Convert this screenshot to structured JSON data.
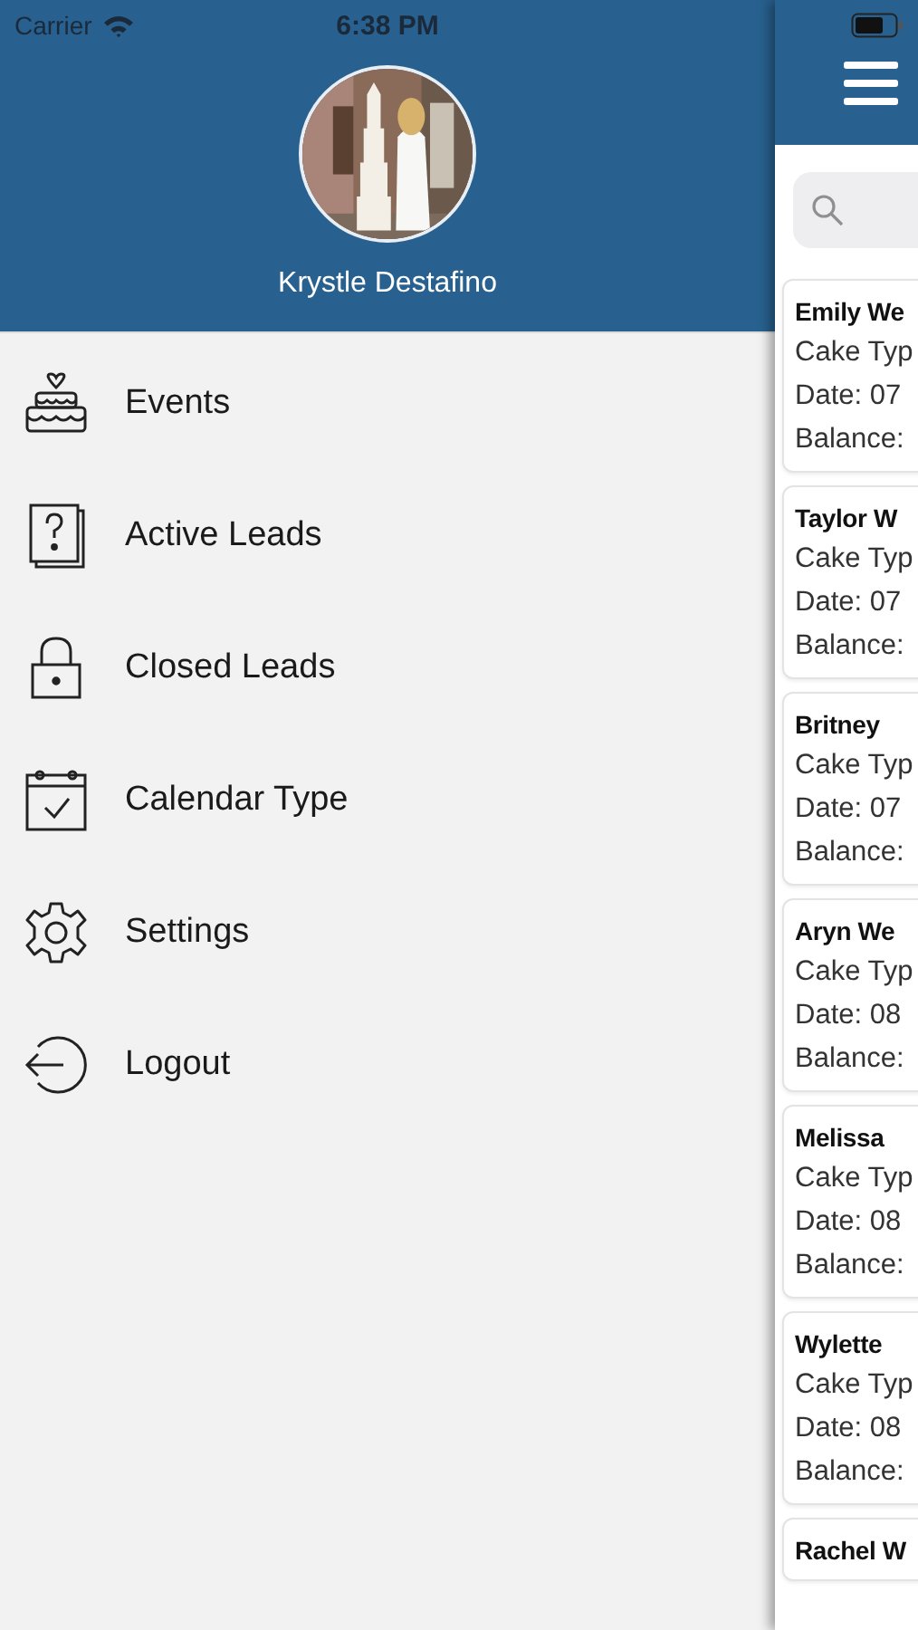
{
  "status_bar": {
    "carrier": "Carrier",
    "time": "6:38 PM"
  },
  "profile": {
    "name": "Krystle Destafino"
  },
  "menu": [
    {
      "label": "Events"
    },
    {
      "label": "Active Leads"
    },
    {
      "label": "Closed Leads"
    },
    {
      "label": "Calendar Type"
    },
    {
      "label": "Settings"
    },
    {
      "label": "Logout"
    }
  ],
  "cards": [
    {
      "name": "Emily We",
      "lines": [
        "Cake Typ",
        "Date: 07",
        "Balance:"
      ]
    },
    {
      "name": "Taylor W",
      "lines": [
        "Cake Typ",
        "Date: 07",
        "Balance:"
      ]
    },
    {
      "name": "Britney",
      "lines": [
        "Cake Typ",
        "Date: 07",
        "Balance:"
      ]
    },
    {
      "name": "Aryn We",
      "lines": [
        "Cake Typ",
        "Date: 08",
        "Balance:"
      ]
    },
    {
      "name": "Melissa",
      "lines": [
        "Cake Typ",
        "Date: 08",
        "Balance:"
      ]
    },
    {
      "name": "Wylette",
      "lines": [
        "Cake Typ",
        "Date: 08",
        "Balance:"
      ]
    },
    {
      "name": "Rachel W"
    }
  ]
}
